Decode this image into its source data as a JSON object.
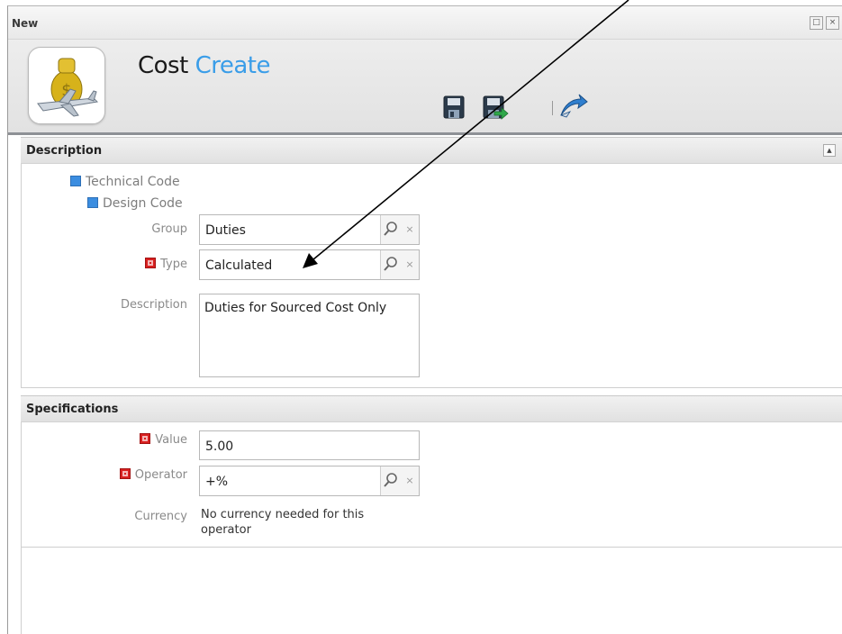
{
  "window": {
    "title": "New"
  },
  "header": {
    "title_main": "Cost",
    "title_accent": "Create"
  },
  "toolbar": {
    "save_icon": "save-icon",
    "save_and_close_icon": "save-and-close-icon",
    "publish_icon": "arrow-icon"
  },
  "description_section": {
    "label": "Description",
    "tree": [
      "Technical Code",
      "Design Code"
    ],
    "group_label": "Group",
    "group_value": "Duties",
    "type_label": "Type",
    "type_value": "Calculated",
    "description_label": "Description",
    "description_value": "Duties for Sourced Cost Only"
  },
  "specifications_section": {
    "label": "Specifications",
    "value_label": "Value",
    "value_value": "5.00",
    "operator_label": "Operator",
    "operator_value": "+%",
    "currency_label": "Currency",
    "currency_value": "No currency needed for this operator"
  },
  "colors": {
    "accent": "#3a9de8",
    "required": "#d82020",
    "tree_marker": "#3b8de0"
  }
}
